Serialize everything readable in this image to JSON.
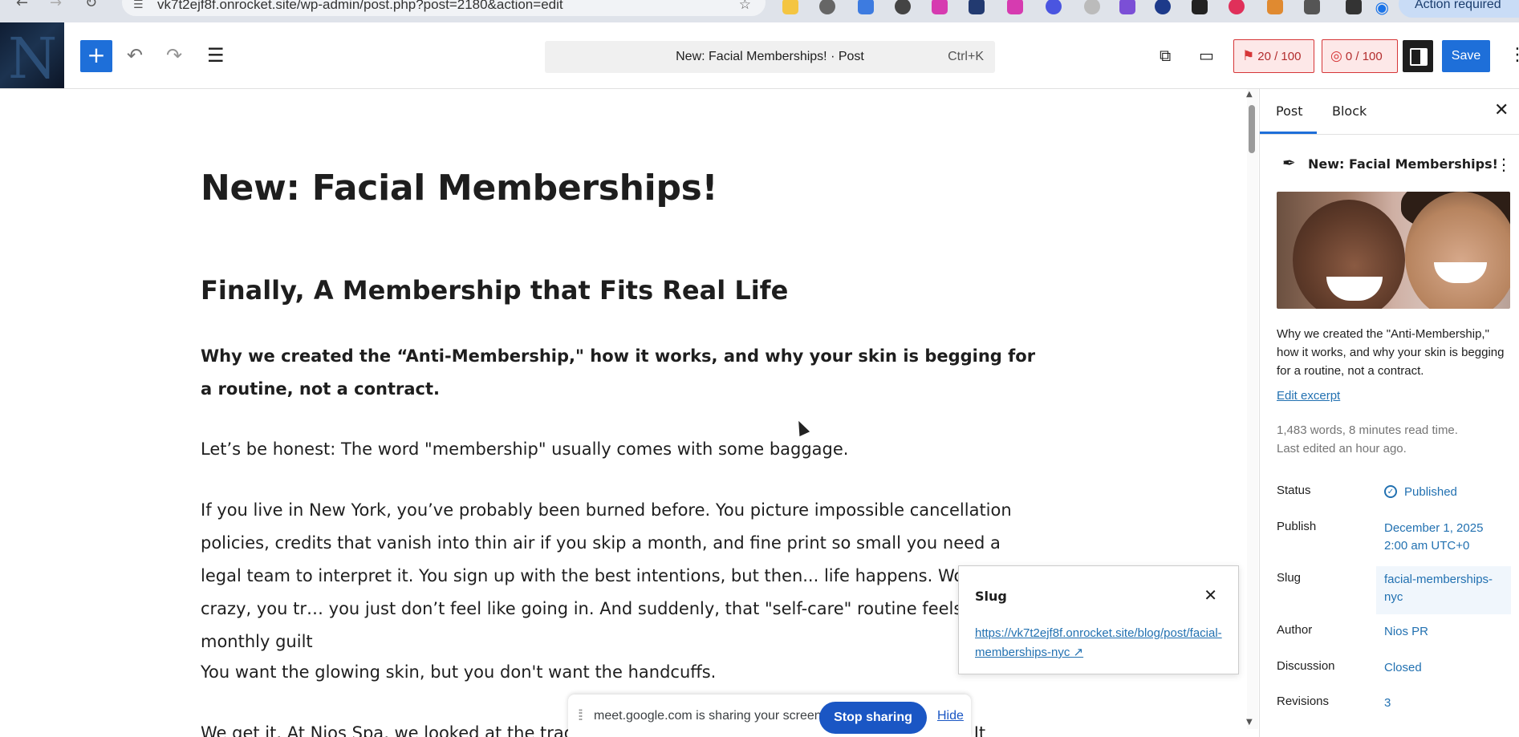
{
  "browser": {
    "url": "vk7t2ejf8f.onrocket.site/wp-admin/post.php?post=2180&action=edit",
    "action_required": "Action required"
  },
  "header": {
    "document_title": "New: Facial Memberships! · Post",
    "shortcut": "Ctrl+K",
    "seo_score": "20 / 100",
    "readability_score": "0 / 100",
    "save_label": "Save"
  },
  "post": {
    "title": "New: Facial Memberships!",
    "heading": "Finally, A Membership that Fits Real Life",
    "intro": "Why we created the “Anti-Membership,\" how it works, and why your skin is begging for a routine, not a contract.",
    "p1": "Let’s be honest: The word \"membership\" usually comes with some baggage.",
    "p2": "If you live in New York, you’ve probably been burned before. You picture impossible cancellation policies, credits that vanish into thin air if you skip a month, and fine print so small you need a legal team to interpret it. You sign up with the best intentions, but then... life happens. Work gets crazy, you tr… you just don’t feel like going in. And suddenly, that \"self-care\" routine feels like a monthly guilt",
    "p3": "You want the glowing skin, but you don't want the handcuffs.",
    "p4": "We get it. At Nios Spa, we looked at the traditi                                                              oken. It"
  },
  "slug_popover": {
    "title": "Slug",
    "link": "https://vk7t2ejf8f.onrocket.site/blog/post/facial-memberships-nyc ↗"
  },
  "share_bar": {
    "text": "meet.google.com is sharing your screen.",
    "stop": "Stop sharing",
    "hide": "Hide"
  },
  "sidebar": {
    "tabs": [
      "Post",
      "Block"
    ],
    "post_title": "New: Facial Memberships!",
    "excerpt": "Why we created the \"Anti-Membership,\" how it works, and why your skin is begging for a routine, not a contract.",
    "edit_excerpt": "Edit excerpt",
    "word_count": "1,483 words, 8 minutes read time.",
    "last_edited": "Last edited an hour ago.",
    "rows": {
      "status_label": "Status",
      "status_value": "Published",
      "publish_label": "Publish",
      "publish_value": "December 1, 2025 2:00 am UTC+0",
      "slug_label": "Slug",
      "slug_value": "facial-memberships-nyc",
      "author_label": "Author",
      "author_value": "Nios PR",
      "discussion_label": "Discussion",
      "discussion_value": "Closed",
      "revisions_label": "Revisions",
      "revisions_value": "3"
    }
  },
  "colors": {
    "accent": "#1e6fd9",
    "link": "#2271b1",
    "score_bad": "#d63638"
  }
}
